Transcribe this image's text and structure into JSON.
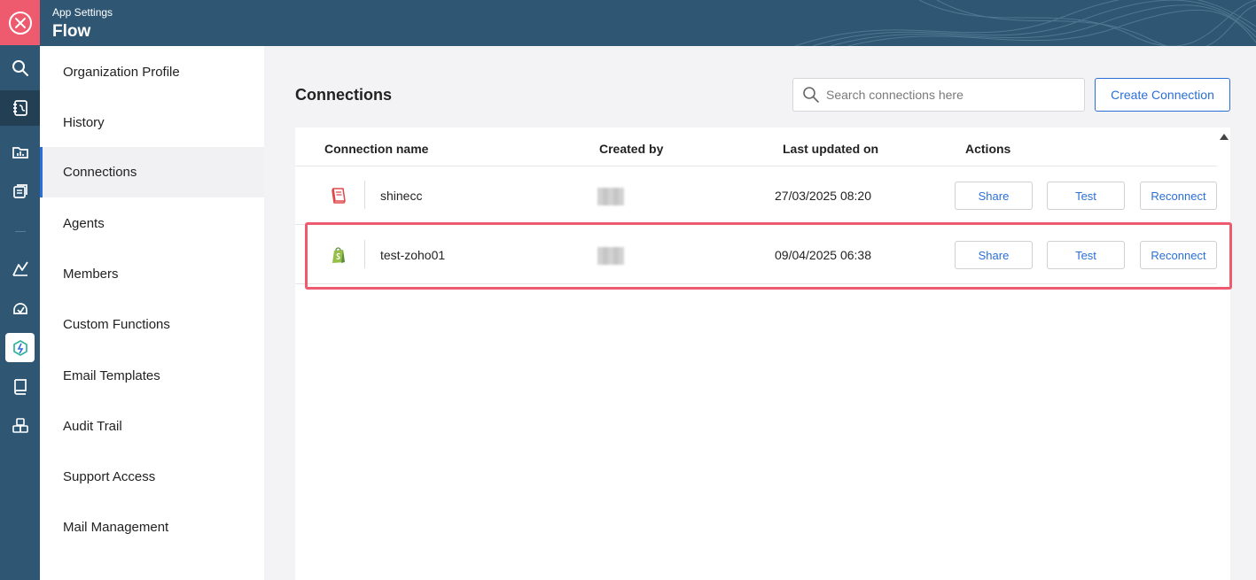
{
  "header": {
    "subtitle": "App Settings",
    "title": "Flow"
  },
  "rail": {
    "icons": [
      "close-icon",
      "search-icon",
      "workflow-icon",
      "folder-chart-icon",
      "layers-icon",
      "chart-icon",
      "gauge-icon",
      "flow-icon",
      "book-icon",
      "cubes-icon"
    ]
  },
  "menu": {
    "items": [
      {
        "label": "Organization Profile"
      },
      {
        "label": "History"
      },
      {
        "label": "Connections"
      },
      {
        "label": "Agents"
      },
      {
        "label": "Members"
      },
      {
        "label": "Custom Functions"
      },
      {
        "label": "Email Templates"
      },
      {
        "label": "Audit Trail"
      },
      {
        "label": "Support Access"
      },
      {
        "label": "Mail Management"
      }
    ],
    "active": "Connections"
  },
  "main": {
    "title": "Connections",
    "search_placeholder": "Search connections here",
    "create_label": "Create Connection"
  },
  "table": {
    "columns": [
      "Connection name",
      "Created by",
      "Last updated on",
      "Actions"
    ],
    "rows": [
      {
        "icon": "book-app-icon",
        "name": "shinecc",
        "updated": "27/03/2025 08:20",
        "share": "Share",
        "test": "Test",
        "reconnect": "Reconnect"
      },
      {
        "icon": "shopify-icon",
        "name": "test-zoho01",
        "updated": "09/04/2025 06:38",
        "share": "Share",
        "test": "Test",
        "reconnect": "Reconnect"
      }
    ]
  },
  "colors": {
    "rail": "#2f5773",
    "accent": "#2b6fd6",
    "close": "#ef5b6e",
    "highlight": "#ef5b6e"
  }
}
